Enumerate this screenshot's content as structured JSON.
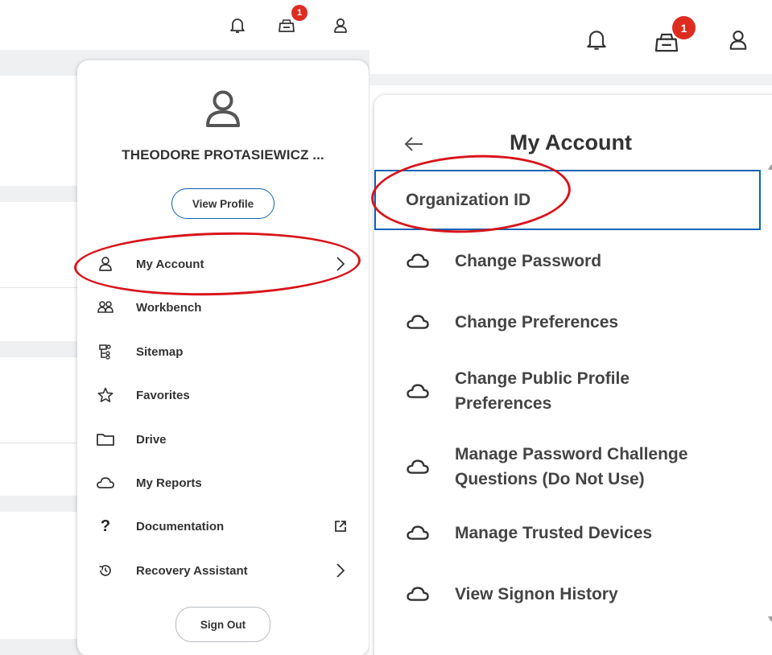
{
  "topbar": {
    "icons": [
      "bell-icon",
      "inbox-icon",
      "user-icon"
    ],
    "inbox_badge": "1"
  },
  "profile_menu": {
    "user_name": "THEODORE PROTASIEWICZ ...",
    "view_profile_label": "View Profile",
    "items": [
      {
        "label": "My Account",
        "icon": "user-icon",
        "trailing": "chevron-right-icon"
      },
      {
        "label": "Workbench",
        "icon": "people-group-icon"
      },
      {
        "label": "Sitemap",
        "icon": "sitemap-icon"
      },
      {
        "label": "Favorites",
        "icon": "star-icon"
      },
      {
        "label": "Drive",
        "icon": "folder-icon"
      },
      {
        "label": "My Reports",
        "icon": "cloud-icon"
      },
      {
        "label": "Documentation",
        "icon": "question-icon",
        "trailing": "external-link-icon"
      },
      {
        "label": "Recovery Assistant",
        "icon": "history-icon",
        "trailing": "chevron-right-icon"
      }
    ],
    "sign_out_label": "Sign Out"
  },
  "account_menu": {
    "title": "My Account",
    "back_icon": "arrow-left-icon",
    "items": [
      {
        "label": "Organization ID",
        "selected": true
      },
      {
        "label": "Change Password",
        "icon": "cloud-icon"
      },
      {
        "label": "Change Preferences",
        "icon": "cloud-icon"
      },
      {
        "label": "Change Public Profile Preferences",
        "icon": "cloud-icon"
      },
      {
        "label": "Manage Password Challenge Questions (Do Not Use)",
        "icon": "cloud-icon"
      },
      {
        "label": "Manage Trusted Devices",
        "icon": "cloud-icon"
      },
      {
        "label": "View Signon History",
        "icon": "cloud-icon"
      }
    ]
  },
  "colors": {
    "badge": "#de2c21",
    "selection_border": "#0b63b6",
    "view_profile_border": "#0b63b6",
    "highlight_oval": "#d9141b",
    "text": "#333333"
  }
}
